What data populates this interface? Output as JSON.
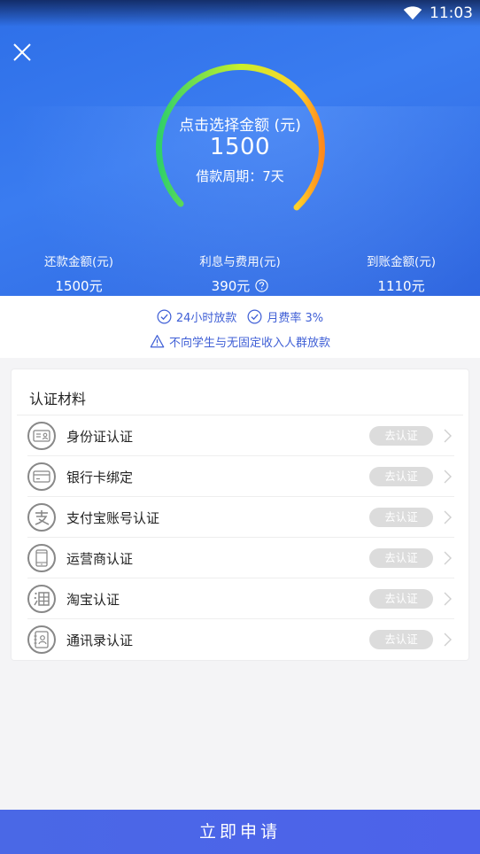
{
  "status_bar": {
    "time": "11:03"
  },
  "loan": {
    "gauge_title": "点击选择金额 (元)",
    "amount": "1500",
    "period": "借款周期：7天"
  },
  "summary": [
    {
      "label": "还款金额(元)",
      "value": "1500元"
    },
    {
      "label": "利息与费用(元)",
      "value": "390元"
    },
    {
      "label": "到账金额(元)",
      "value": "1110元"
    }
  ],
  "notice": {
    "feature1": "24小时放款",
    "feature2": "月费率 3%",
    "warning": "不向学生与无固定收入人群放款"
  },
  "verification": {
    "title": "认证材料",
    "items": [
      {
        "label": "身份证认证",
        "button": "去认证",
        "icon": "id-card-icon"
      },
      {
        "label": "银行卡绑定",
        "button": "去认证",
        "icon": "bank-card-icon"
      },
      {
        "label": "支付宝账号认证",
        "button": "去认证",
        "icon": "alipay-icon"
      },
      {
        "label": "运营商认证",
        "button": "去认证",
        "icon": "phone-icon"
      },
      {
        "label": "淘宝认证",
        "button": "去认证",
        "icon": "taobao-icon"
      },
      {
        "label": "通讯录认证",
        "button": "去认证",
        "icon": "contacts-icon"
      }
    ]
  },
  "apply_button": "立即申请",
  "colors": {
    "primary": "#3a7cf0",
    "accent_text": "#3f5fd6",
    "button_bar": "#4a68e6"
  }
}
